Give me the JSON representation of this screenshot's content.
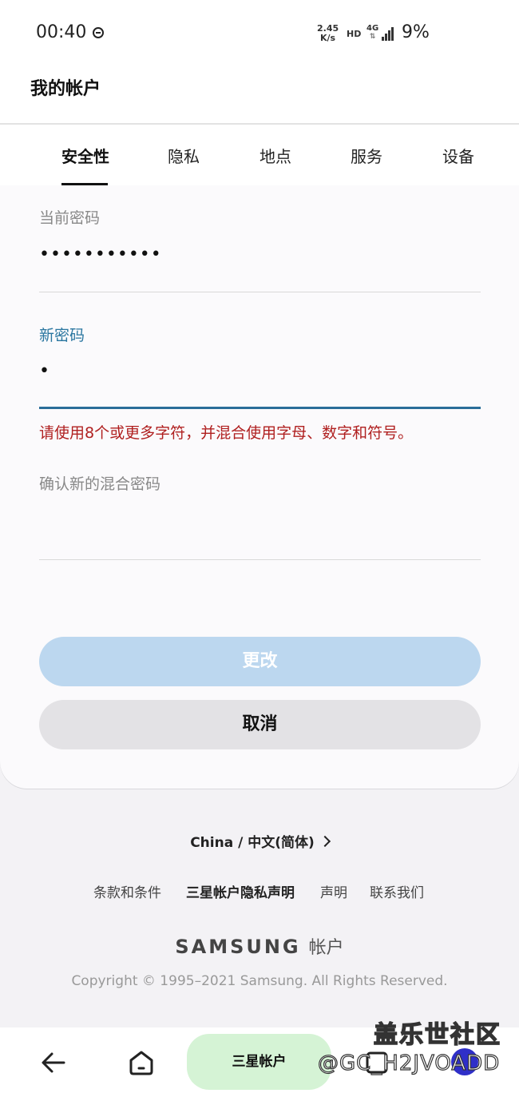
{
  "status_bar": {
    "time": "00:40",
    "speed_value": "2.45",
    "speed_unit": "K/s",
    "hd": "HD",
    "network": "4G",
    "battery": "9%"
  },
  "header": {
    "title": "我的帐户"
  },
  "tabs": [
    {
      "label": "安全性",
      "active": true
    },
    {
      "label": "隐私"
    },
    {
      "label": "地点"
    },
    {
      "label": "服务"
    },
    {
      "label": "设备"
    }
  ],
  "form": {
    "current_password": {
      "label": "当前密码",
      "value": "•••••••••••"
    },
    "new_password": {
      "label": "新密码",
      "value": "•"
    },
    "error": "请使用8个或更多字符，并混合使用字母、数字和符号。",
    "confirm_password": {
      "label": "确认新的混合密码",
      "value": ""
    },
    "submit_label": "更改",
    "cancel_label": "取消"
  },
  "footer": {
    "locale": "China / 中文(简体)",
    "links": [
      "条款和条件",
      "三星帐户隐私声明",
      "声明",
      "联系我们"
    ],
    "brand": "SAMSUNG",
    "brand_suffix": "帐户",
    "copyright": "Copyright © 1995–2021 Samsung. All Rights Reserved."
  },
  "navbar": {
    "app_label": "三星帐户"
  },
  "watermark": {
    "site": "盖乐世社区",
    "id": "@GC_H2JVOADD"
  }
}
